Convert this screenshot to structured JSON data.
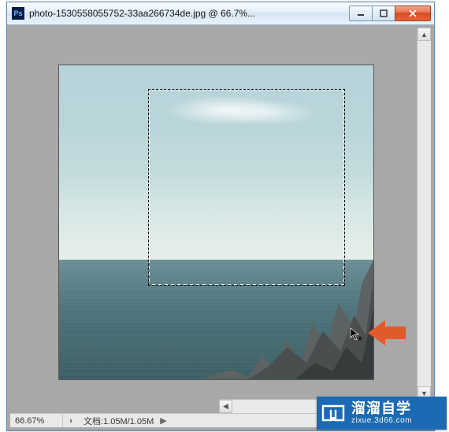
{
  "window": {
    "app_icon_label": "Ps",
    "title": "photo-1530558055752-33aa266734de.jpg @ 66.7%..."
  },
  "status": {
    "zoom": "66.67%",
    "doc_label_prefix": "文档:",
    "doc_size": "1.05M/1.05M"
  },
  "watermark": {
    "cn": "溜溜自学",
    "en": "zixue.3d66.com"
  },
  "annotation": {
    "cursor_name": "move-cursor",
    "arrow_color": "#e15a2b"
  }
}
